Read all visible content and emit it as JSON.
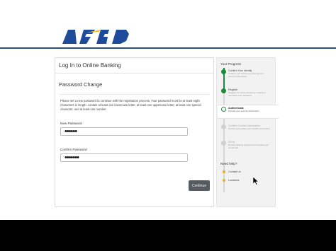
{
  "logo": {
    "text": "ASFD"
  },
  "panel": {
    "title": "Log In to Online Banking",
    "subtitle": "Password Change",
    "instructions": "Please set a new password to continue with the registration process. Your password must be at least eight characters in length, contain at least one lowercase letter, at least one uppercase letter, at least one special character, and at least one number.",
    "new_password_label": "New Password",
    "new_password_value_masked": "••••••",
    "confirm_password_label": "Confirm Password",
    "confirm_password_value_masked": "•••••••",
    "continue_label": "Continue"
  },
  "progress": {
    "title": "Your Progress",
    "steps": [
      {
        "title": "Confirm Your Identity",
        "desc": "Confirm your identity by entering your account information"
      },
      {
        "title": "Register",
        "desc": "Register for online access by creating a username and password"
      },
      {
        "title": "Authenticate",
        "desc": "Provide your security information"
      },
      {
        "title": "Confirm Contact Information",
        "desc": "Review and update your contact information"
      },
      {
        "title": "Enroll",
        "desc": "Review banking options and complete your enrollment"
      }
    ]
  },
  "help": {
    "title": "Need help?",
    "contact_label": "Contact Us",
    "locations_label": "Locations"
  },
  "colors": {
    "brand_blue": "#1f4c9a",
    "progress_green": "#1f8a3a",
    "button_gray": "#555b61",
    "help_icon_yellow": "#e3b23c"
  }
}
